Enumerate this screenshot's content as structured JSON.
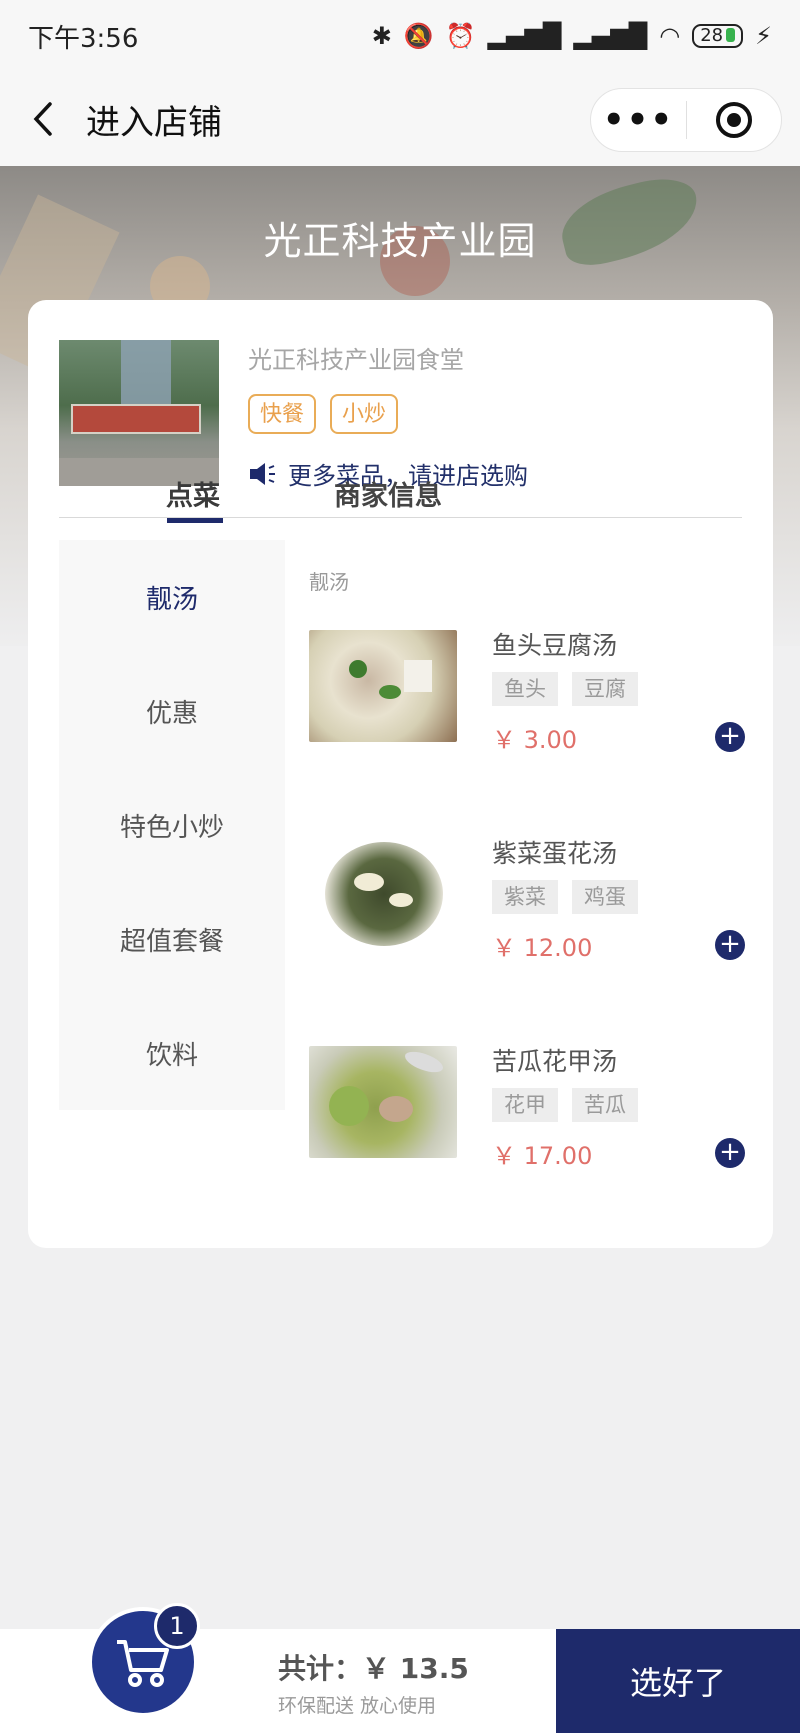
{
  "status_bar": {
    "time": "下午3:56",
    "battery": "28"
  },
  "nav": {
    "title": "进入店铺",
    "more_icon": "•••"
  },
  "hero": {
    "title": "光正科技产业园"
  },
  "shop": {
    "name": "光正科技产业园食堂",
    "tags": [
      "快餐",
      "小炒"
    ],
    "notice": "更多菜品，请进店选购"
  },
  "tabs": [
    {
      "label": "点菜",
      "active": true
    },
    {
      "label": "商家信息",
      "active": false
    }
  ],
  "categories": [
    {
      "label": "靓汤",
      "active": true
    },
    {
      "label": "优惠",
      "active": false
    },
    {
      "label": "特色小炒",
      "active": false
    },
    {
      "label": "超值套餐",
      "active": false
    },
    {
      "label": "饮料",
      "active": false
    }
  ],
  "section": {
    "title": "靓汤"
  },
  "dishes": [
    {
      "name": "鱼头豆腐汤",
      "tags": [
        "鱼头",
        "豆腐"
      ],
      "price": "￥ 3.00"
    },
    {
      "name": "紫菜蛋花汤",
      "tags": [
        "紫菜",
        "鸡蛋"
      ],
      "price": "￥ 12.00"
    },
    {
      "name": "苦瓜花甲汤",
      "tags": [
        "花甲",
        "苦瓜"
      ],
      "price": "￥ 17.00"
    }
  ],
  "cart": {
    "count": "1",
    "total": "共计：￥ 13.5",
    "subtitle": "环保配送 放心使用",
    "submit_label": "选好了"
  },
  "colors": {
    "brand_navy": "#1e2a6b",
    "tag_orange": "#e9a04c",
    "price_red": "#e0706a"
  }
}
